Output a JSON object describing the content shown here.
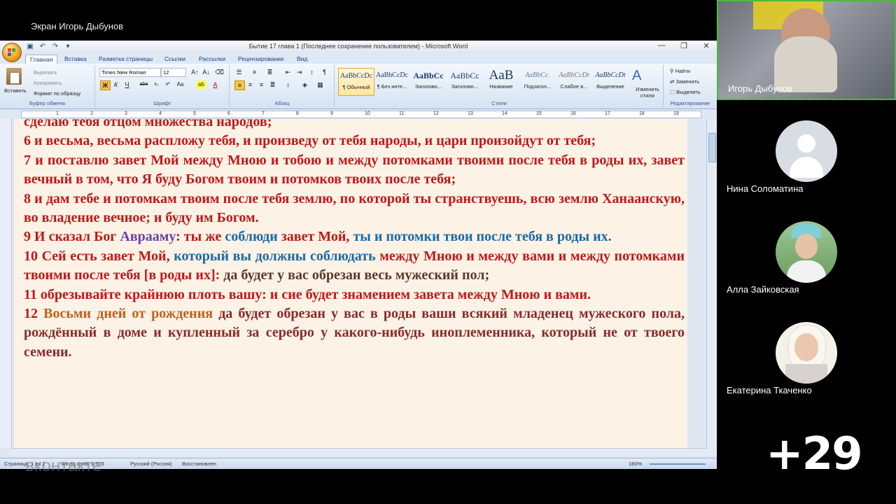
{
  "share_title": "Экран Игорь Дыбунов",
  "word": {
    "window_title": "Бытие 17 глава 1 (Последнее сохранение пользователем) - Microsoft Word",
    "tabs": [
      "Главная",
      "Вставка",
      "Разметка страницы",
      "Ссылки",
      "Рассылки",
      "Рецензирование",
      "Вид"
    ],
    "clipboard": {
      "paste": "Вставить",
      "cut": "Вырезать",
      "copy": "Копировать",
      "format": "Формат по образцу",
      "label": "Буфер обмена"
    },
    "font": {
      "name": "Times New Roman",
      "size": "12",
      "label": "Шрифт"
    },
    "paragraph_label": "Абзац",
    "styles": [
      {
        "preview": "AaBbCcDc",
        "name": "¶ Обычный"
      },
      {
        "preview": "AaBbCcDc",
        "name": "¶ Без инте..."
      },
      {
        "preview": "AaBbCc",
        "name": "Заголово..."
      },
      {
        "preview": "AaBbCc",
        "name": "Заголово..."
      },
      {
        "preview": "AaB",
        "name": "Название"
      },
      {
        "preview": "AaBbCc.",
        "name": "Подзагол..."
      },
      {
        "preview": "AaBbCcDt",
        "name": "Слабое в..."
      },
      {
        "preview": "AaBbCcDt",
        "name": "Выделение"
      }
    ],
    "styles_label": "Стили",
    "change_styles": "Изменить стили",
    "editing": {
      "find": "Найти",
      "replace": "Заменить",
      "select": "Выделить",
      "label": "Редактирование"
    },
    "status": {
      "page": "Страница: 1 из 1",
      "words": "Число слов: 6 578",
      "lang": "Русский (Россия)",
      "recovered": "Восстановлен",
      "zoom": "180%"
    }
  },
  "document": {
    "line_top": "сделаю тебя отцом множества народов;",
    "v6": "6 и весьма, весьма распложу тебя, и произведу от тебя народы, и цари произойдут от тебя;",
    "v7": "7 и поставлю завет Мой между Мною и тобою и между потомками твоими после тебя в роды их, завет вечный в том, что Я буду Богом твоим и потомков твоих после тебя;",
    "v8": "8 и дам тебе и потомкам твоим после тебя землю, по которой ты странствуешь, всю землю Ханаанскую, во владение вечное; и буду им Богом.",
    "v9_num": "9 И",
    "v9_a": " сказал Бог ",
    "v9_name": "Аврааму",
    "v9_b": ": ты же ",
    "v9_c": "соблюди",
    "v9_d": " завет Мой, ",
    "v9_e": "ты и потомки твои после тебя в роды их.",
    "v10_a": "10 Сей есть завет Мой, ",
    "v10_b": "который вы должны соблюдать",
    "v10_c": " между Мною и между вами и между потомками твоими после тебя [в роды их]: ",
    "v10_d": "да будет у вас обрезан весь мужеский пол;",
    "v11_a": "11 обрезывайте крайнюю плоть вашу: ",
    "v11_b": "и сие будет знамением завета между Мною и вами.",
    "v12_a": "12 ",
    "v12_b": "Восьми дней от рождения",
    "v12_c": " да будет обрезан у вас в роды ваши всякий младенец мужеского пола, рождённый в доме и купленный за серебро у какого-нибудь иноплеменника, который не от твоего семени."
  },
  "participants": [
    {
      "name": "Игорь Дыбунов"
    },
    {
      "name": "Нина Соломатина"
    },
    {
      "name": "Алла Зайковская"
    },
    {
      "name": "Екатерина Ткаченко"
    }
  ],
  "more_count": "+29",
  "watermark": "вконтакте"
}
